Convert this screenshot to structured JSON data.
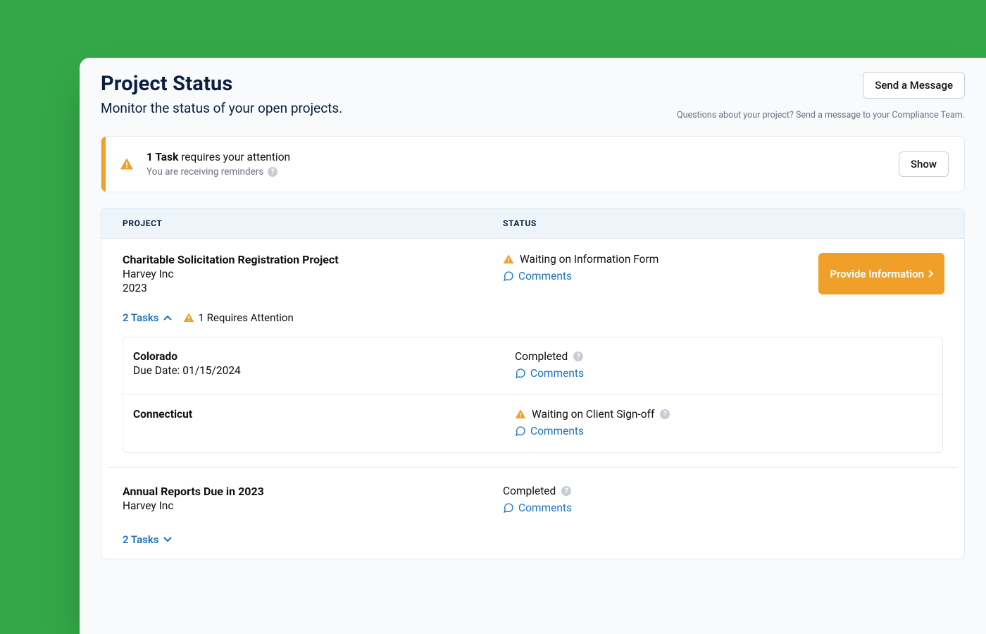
{
  "header": {
    "title": "Project Status",
    "subtitle": "Monitor the status of your open projects.",
    "send_message": "Send a Message",
    "questions": "Questions about your project? Send a message to your Compliance Team."
  },
  "alert": {
    "bold": "1 Task",
    "rest": " requires your attention",
    "reminders": "You are receiving reminders",
    "show": "Show"
  },
  "table": {
    "col_project": "PROJECT",
    "col_status": "STATUS"
  },
  "projects": [
    {
      "name": "Charitable Solicitation Registration Project",
      "org": "Harvey Inc",
      "year": "2023",
      "status": "Waiting on Information Form",
      "status_warn": true,
      "comments": "Comments",
      "action": "Provide Information",
      "tasks_label": "2 Tasks",
      "expanded": true,
      "requires_attention": "1 Requires Attention",
      "subtasks": [
        {
          "name": "Colorado",
          "due": "Due Date: 01/15/2024",
          "status": "Completed",
          "status_warn": false,
          "comments": "Comments"
        },
        {
          "name": "Connecticut",
          "due": "",
          "status": "Waiting on Client Sign-off",
          "status_warn": true,
          "comments": "Comments"
        }
      ]
    },
    {
      "name": "Annual Reports Due in 2023",
      "org": "Harvey Inc",
      "year": "",
      "status": "Completed",
      "status_warn": false,
      "comments": "Comments",
      "action": "",
      "tasks_label": "2 Tasks",
      "expanded": false,
      "requires_attention": "",
      "subtasks": []
    }
  ]
}
